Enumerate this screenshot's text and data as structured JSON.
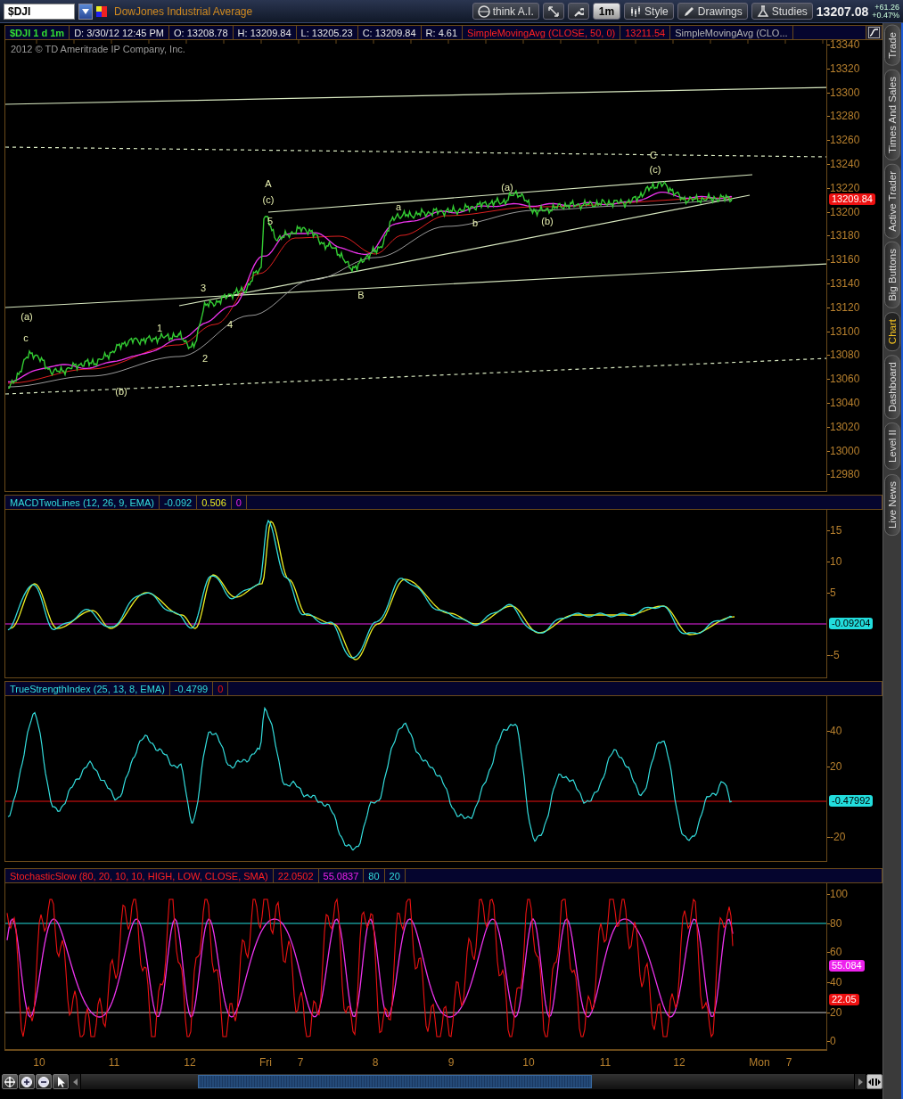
{
  "toolbar": {
    "symbol": "$DJI",
    "description": "DowJones Industrial Average",
    "buttons": [
      {
        "kind": "ai",
        "label": "think A.I."
      },
      {
        "kind": "tools"
      },
      {
        "kind": "aggregation",
        "label": "1m"
      },
      {
        "kind": "style",
        "label": "Style"
      },
      {
        "kind": "drawings",
        "label": "Drawings"
      },
      {
        "kind": "studies",
        "label": "Studies"
      }
    ],
    "last_price": "13207.08",
    "change": "+61.26",
    "change_percent": "+0.47%"
  },
  "chart_header": {
    "cells": [
      {
        "text": "$DJI 1 d 1m",
        "kind": "symbol"
      },
      {
        "text": "D: 3/30/12 12:45 PM",
        "kind": "field"
      },
      {
        "text": "O: 13208.78",
        "kind": "field"
      },
      {
        "text": "H: 13209.84",
        "kind": "field"
      },
      {
        "text": "L: 13205.23",
        "kind": "field"
      },
      {
        "text": "C: 13209.84",
        "kind": "field"
      },
      {
        "text": "R: 4.61",
        "kind": "field"
      },
      {
        "text": "SimpleMovingAvg (CLOSE, 50, 0)",
        "kind": "study"
      },
      {
        "text": "13211.54",
        "kind": "study"
      },
      {
        "text": "SimpleMovingAvg (CLO...",
        "kind": "other_study"
      }
    ]
  },
  "copyright": "2012 © TD Ameritrade IP Company, Inc.",
  "price_panel": {
    "axis_labels": [
      "13340",
      "13320",
      "13300",
      "13280",
      "13260",
      "13240",
      "13220",
      "13200",
      "13180",
      "13160",
      "13140",
      "13120",
      "13100",
      "13080",
      "13060",
      "13040",
      "13020",
      "13000",
      "12980"
    ],
    "price_tag": {
      "text": "13209.84",
      "color": "#ee1111"
    },
    "wave_labels": [
      "A",
      "(c)",
      "5",
      "a",
      "(a)",
      "b",
      "(b)",
      "B",
      "C",
      "(c)",
      "3",
      "1",
      "4",
      "2",
      "(a)",
      "c",
      "(b)"
    ]
  },
  "studies": [
    {
      "kind": "macd",
      "cells": [
        {
          "text": "MACDTwoLines (12, 26, 9, EMA)",
          "kind": "title"
        },
        {
          "text": "-0.092",
          "kind": "main"
        },
        {
          "text": "0.506",
          "kind": "signal"
        },
        {
          "text": "0",
          "kind": "zero"
        }
      ],
      "axis_labels": [
        "15",
        "10",
        "5",
        "-5"
      ],
      "tags": [
        {
          "text": "-0.09204",
          "color": "#22dddd"
        }
      ]
    },
    {
      "kind": "tsi",
      "cells": [
        {
          "text": "TrueStrengthIndex (25, 13, 8, EMA)",
          "kind": "title"
        },
        {
          "text": "-0.4799",
          "kind": "main"
        },
        {
          "text": "0",
          "kind": "zero"
        }
      ],
      "axis_labels": [
        "40",
        "20",
        "-20"
      ],
      "tags": [
        {
          "text": "-0.47992",
          "color": "#22dddd"
        }
      ]
    },
    {
      "kind": "stochastic",
      "cells": [
        {
          "text": "StochasticSlow (80, 20, 10, 10, HIGH, LOW, CLOSE, SMA)",
          "kind": "title"
        },
        {
          "text": "22.0502",
          "kind": "main"
        },
        {
          "text": "55.0837",
          "kind": "signal"
        },
        {
          "text": "80",
          "kind": "over_bought"
        },
        {
          "text": "20",
          "kind": "over_sold"
        }
      ],
      "axis_labels": [
        "100",
        "80",
        "60",
        "40",
        "20",
        "0"
      ],
      "tags": [
        {
          "text": "55.084",
          "color": "#ee22ee"
        },
        {
          "text": "22.05",
          "color": "#ee1111"
        }
      ]
    }
  ],
  "time_axis": [
    "10",
    "11",
    "12",
    "Fri",
    "7",
    "8",
    "9",
    "10",
    "11",
    "12",
    "Mon",
    "7"
  ],
  "side_tabs": [
    {
      "label": "Trade",
      "selected": false
    },
    {
      "label": "Times And Sales",
      "selected": false
    },
    {
      "label": "Active Trader",
      "selected": false
    },
    {
      "label": "Big Buttons",
      "selected": false
    },
    {
      "label": "Chart",
      "selected": true
    },
    {
      "label": "Dashboard",
      "selected": false
    },
    {
      "label": "Level II",
      "selected": false
    },
    {
      "label": "Live News",
      "selected": false
    }
  ]
}
